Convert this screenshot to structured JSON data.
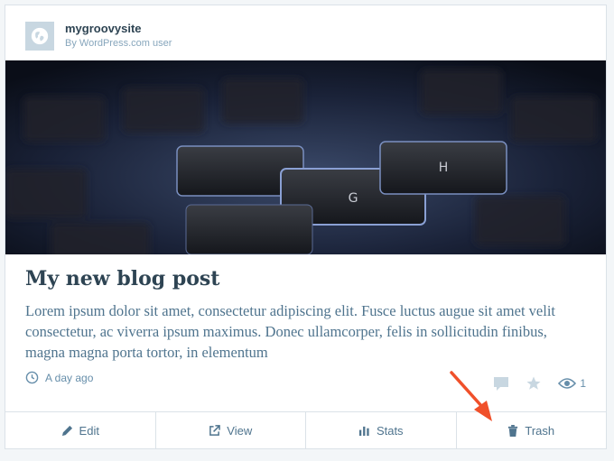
{
  "site": {
    "name": "mygroovysite",
    "subtitle": "By WordPress.com user",
    "icon": "wordpress-globe-icon"
  },
  "post": {
    "title": "My new blog post",
    "excerpt": "Lorem ipsum dolor sit amet, consectetur adipiscing elit. Fusce luctus augue sit amet velit consectetur, ac viverra ipsum maximus. Donec ullamcorper, felis in sollicitudin finibus, magna magna porta tortor, in elementum",
    "time": "A day ago",
    "views": "1"
  },
  "actions": {
    "edit": "Edit",
    "view": "View",
    "stats": "Stats",
    "trash": "Trash"
  },
  "colors": {
    "accent": "#4f748e",
    "annotation_arrow": "#f0502a"
  }
}
